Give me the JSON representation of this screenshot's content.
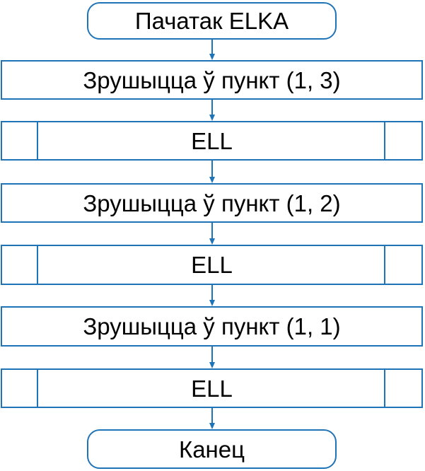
{
  "diagram": {
    "colors": {
      "line": "#1f73b7",
      "text": "#000000",
      "background": "#ffffff"
    },
    "nodes": {
      "start": "Пачатак ELKA",
      "step_1": "Зрушыцца ў пункт (1, 3)",
      "step_2": "ELL",
      "step_3": "Зрушыцца ў пункт (1, 2)",
      "step_4": "ELL",
      "step_5": "Зрушыцца ў пункт (1, 1)",
      "step_6": "ELL",
      "end": "Канец"
    }
  }
}
